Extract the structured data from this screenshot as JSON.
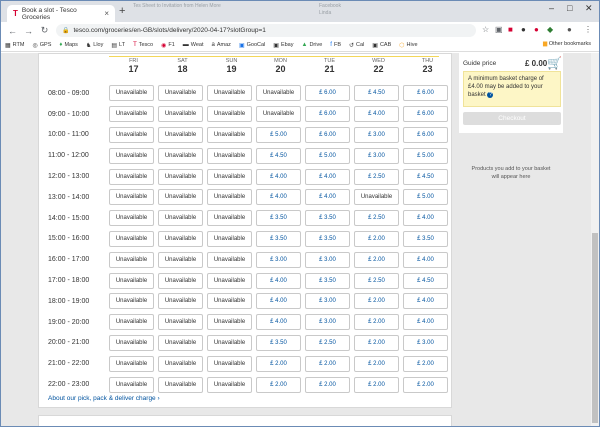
{
  "browser": {
    "tab_title": "Book a slot - Tesco Groceries",
    "new_tab": "+",
    "url": "tesco.com/groceries/en-GB/slots/delivery/2020-04-17?slotGroup=1",
    "ghost_tabs": [
      "Tes Sheet to Invitation from Helen More",
      "Facebook",
      "Linda"
    ],
    "bookmarks": [
      "RTM",
      "GPS",
      "Maps",
      "Lloy",
      "LT",
      "Tesco",
      "F1",
      "Weat",
      "Amaz",
      "GooCal",
      "Ebay",
      "Drive",
      "FB",
      "Cal",
      "CAB",
      "Hive"
    ],
    "other_bookmarks": "Other bookmarks"
  },
  "slots": {
    "days": [
      {
        "name": "FRI",
        "num": "17"
      },
      {
        "name": "SAT",
        "num": "18"
      },
      {
        "name": "SUN",
        "num": "19"
      },
      {
        "name": "MON",
        "num": "20"
      },
      {
        "name": "TUE",
        "num": "21"
      },
      {
        "name": "WED",
        "num": "22"
      },
      {
        "name": "THU",
        "num": "23"
      }
    ],
    "rows": [
      {
        "time": "08:00 - 09:00",
        "cells": [
          "Unavailable",
          "Unavailable",
          "Unavailable",
          "Unavailable",
          "£ 6.00",
          "£ 4.50",
          "£ 6.00"
        ]
      },
      {
        "time": "09:00 - 10:00",
        "cells": [
          "Unavailable",
          "Unavailable",
          "Unavailable",
          "Unavailable",
          "£ 6.00",
          "£ 4.00",
          "£ 6.00"
        ]
      },
      {
        "time": "10:00 - 11:00",
        "cells": [
          "Unavailable",
          "Unavailable",
          "Unavailable",
          "£ 5.00",
          "£ 6.00",
          "£ 3.00",
          "£ 6.00"
        ]
      },
      {
        "time": "11:00 - 12:00",
        "cells": [
          "Unavailable",
          "Unavailable",
          "Unavailable",
          "£ 4.50",
          "£ 5.00",
          "£ 3.00",
          "£ 5.00"
        ]
      },
      {
        "time": "12:00 - 13:00",
        "cells": [
          "Unavailable",
          "Unavailable",
          "Unavailable",
          "£ 4.00",
          "£ 4.00",
          "£ 2.50",
          "£ 4.50"
        ]
      },
      {
        "time": "13:00 - 14:00",
        "cells": [
          "Unavailable",
          "Unavailable",
          "Unavailable",
          "£ 4.00",
          "£ 4.00",
          "Unavailable",
          "£ 5.00"
        ]
      },
      {
        "time": "14:00 - 15:00",
        "cells": [
          "Unavailable",
          "Unavailable",
          "Unavailable",
          "£ 3.50",
          "£ 3.50",
          "£ 2.50",
          "£ 4.00"
        ]
      },
      {
        "time": "15:00 - 16:00",
        "cells": [
          "Unavailable",
          "Unavailable",
          "Unavailable",
          "£ 3.50",
          "£ 3.50",
          "£ 2.00",
          "£ 3.50"
        ]
      },
      {
        "time": "16:00 - 17:00",
        "cells": [
          "Unavailable",
          "Unavailable",
          "Unavailable",
          "£ 3.00",
          "£ 3.00",
          "£ 2.00",
          "£ 4.00"
        ]
      },
      {
        "time": "17:00 - 18:00",
        "cells": [
          "Unavailable",
          "Unavailable",
          "Unavailable",
          "£ 4.00",
          "£ 3.50",
          "£ 2.50",
          "£ 4.50"
        ]
      },
      {
        "time": "18:00 - 19:00",
        "cells": [
          "Unavailable",
          "Unavailable",
          "Unavailable",
          "£ 4.00",
          "£ 3.00",
          "£ 2.00",
          "£ 4.00"
        ]
      },
      {
        "time": "19:00 - 20:00",
        "cells": [
          "Unavailable",
          "Unavailable",
          "Unavailable",
          "£ 4.00",
          "£ 3.00",
          "£ 2.00",
          "£ 4.00"
        ]
      },
      {
        "time": "20:00 - 21:00",
        "cells": [
          "Unavailable",
          "Unavailable",
          "Unavailable",
          "£ 3.50",
          "£ 2.50",
          "£ 2.00",
          "£ 3.00"
        ]
      },
      {
        "time": "21:00 - 22:00",
        "cells": [
          "Unavailable",
          "Unavailable",
          "Unavailable",
          "£ 2.00",
          "£ 2.00",
          "£ 2.00",
          "£ 2.00"
        ]
      },
      {
        "time": "22:00 - 23:00",
        "cells": [
          "Unavailable",
          "Unavailable",
          "Unavailable",
          "£ 2.00",
          "£ 2.00",
          "£ 2.00",
          "£ 2.00"
        ]
      }
    ],
    "footer_link": "About our pick, pack & deliver charge ›"
  },
  "basket": {
    "guide_label": "Guide price",
    "total": "£ 0.00",
    "notice": "A minimum basket charge of £4.00 may be added to your basket",
    "checkout_label": "Checkout",
    "empty_message": "Products you add to your basket will appear here"
  },
  "colors": {
    "link": "#00539f",
    "tesco_red": "#d50032",
    "notice_bg": "#fdf6c6"
  }
}
